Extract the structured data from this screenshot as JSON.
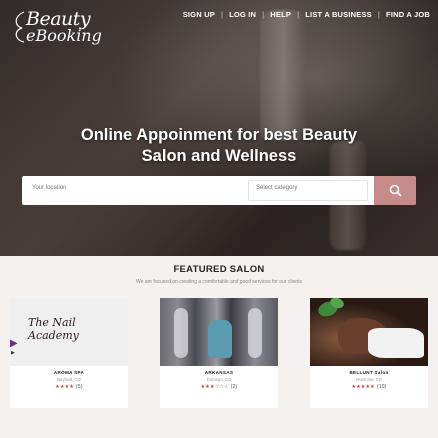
{
  "brand": {
    "logo_line1": "Beauty",
    "logo_line2": "eBooking"
  },
  "nav": {
    "items": [
      "SIGN UP",
      "LOG IN",
      "HELP",
      "LIST A BUSINESS",
      "FIND A JOB"
    ],
    "separator": "|"
  },
  "hero": {
    "headline_line1": "Online Appoinment for best Beauty",
    "headline_line2": "Salon and Wellness"
  },
  "search": {
    "location_placeholder": "Your location",
    "category_placeholder": "Select category",
    "button_icon": "search-icon"
  },
  "featured": {
    "title": "FEATURED SALON",
    "subtitle": "We are focused on creating a comfortable and good services for our clients",
    "cards": [
      {
        "image_text": "The Nail Academy",
        "name": "AROMA SPA",
        "location": "Bayfield, CO",
        "stars": "★★★★",
        "count": "(5)"
      },
      {
        "name": "ARKANSAS",
        "location": "Durango, CO",
        "stars": "★★★☆☆☆",
        "count": "(2)"
      },
      {
        "name": "BELLUNT Salon",
        "location": "Montrose, CO",
        "stars": "★★★★★",
        "count": "(10)"
      }
    ]
  },
  "colors": {
    "accent": "#c58a8a",
    "rating": "#c0392b"
  }
}
